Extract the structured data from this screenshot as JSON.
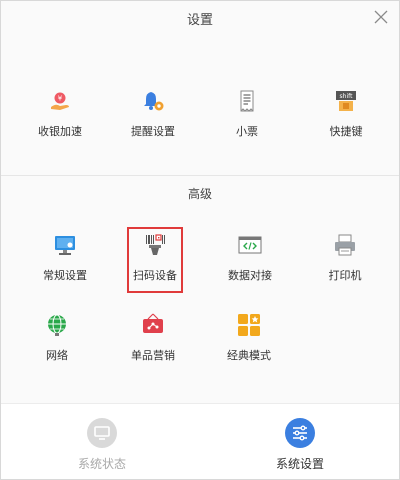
{
  "window": {
    "title": "设置"
  },
  "sections": {
    "basic": {
      "items": [
        {
          "label": "收银加速",
          "icon": "hand-coin-icon"
        },
        {
          "label": "提醒设置",
          "icon": "bell-gear-icon"
        },
        {
          "label": "小票",
          "icon": "receipt-icon"
        },
        {
          "label": "快捷键",
          "icon": "shift-key-icon",
          "key_text": "shift"
        }
      ]
    },
    "advanced": {
      "title": "高级",
      "items": [
        {
          "label": "常规设置",
          "icon": "monitor-gear-icon"
        },
        {
          "label": "扫码设备",
          "icon": "barcode-scanner-icon",
          "selected": true
        },
        {
          "label": "数据对接",
          "icon": "code-window-icon"
        },
        {
          "label": "打印机",
          "icon": "printer-icon"
        },
        {
          "label": "网络",
          "icon": "globe-icon"
        },
        {
          "label": "单品营销",
          "icon": "marketing-board-icon"
        },
        {
          "label": "经典模式",
          "icon": "grid-tiles-icon"
        }
      ]
    }
  },
  "footer": {
    "tabs": [
      {
        "label": "系统状态",
        "icon": "monitor-icon",
        "active": false
      },
      {
        "label": "系统设置",
        "icon": "sliders-icon",
        "active": true
      }
    ]
  },
  "colors": {
    "highlight": "#e03a3a",
    "accent_blue": "#3b7fe0",
    "inactive": "#c8c8c8"
  }
}
